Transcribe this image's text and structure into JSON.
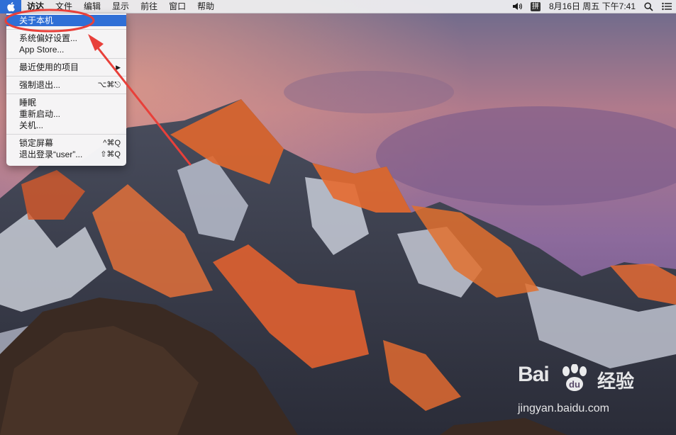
{
  "menubar": {
    "apple_icon": "apple-logo-icon",
    "items": [
      "访达",
      "文件",
      "编辑",
      "显示",
      "前往",
      "窗口",
      "帮助"
    ],
    "status": {
      "volume_icon": "speaker-icon",
      "input_method": "拼",
      "datetime": "8月16日 周五 下午7:41",
      "search_icon": "magnifier-icon",
      "list_icon": "notification-list-icon"
    }
  },
  "apple_menu": {
    "items": [
      {
        "label": "关于本机",
        "shortcut": "",
        "selected": true
      },
      {
        "label": "系统偏好设置...",
        "shortcut": ""
      },
      {
        "label": "App Store...",
        "shortcut": ""
      },
      {
        "label": "最近使用的项目",
        "shortcut": "▶"
      },
      {
        "label": "强制退出...",
        "shortcut": "⌥⌘⎋"
      },
      {
        "label": "睡眠",
        "shortcut": ""
      },
      {
        "label": "重新启动...",
        "shortcut": ""
      },
      {
        "label": "关机...",
        "shortcut": ""
      },
      {
        "label": "锁定屏幕",
        "shortcut": "^⌘Q"
      },
      {
        "label": "退出登录“user”...",
        "shortcut": "⇧⌘Q"
      }
    ]
  },
  "annotation": {
    "color": "#e8403a"
  },
  "watermark": {
    "logo_text": "Bai",
    "logo_cn": "经验",
    "url": "jingyan.baidu.com"
  },
  "colors": {
    "accent": "#2f6fd6",
    "sky_top": "#7a6a8c",
    "alpen_glow": "#e86a30"
  }
}
